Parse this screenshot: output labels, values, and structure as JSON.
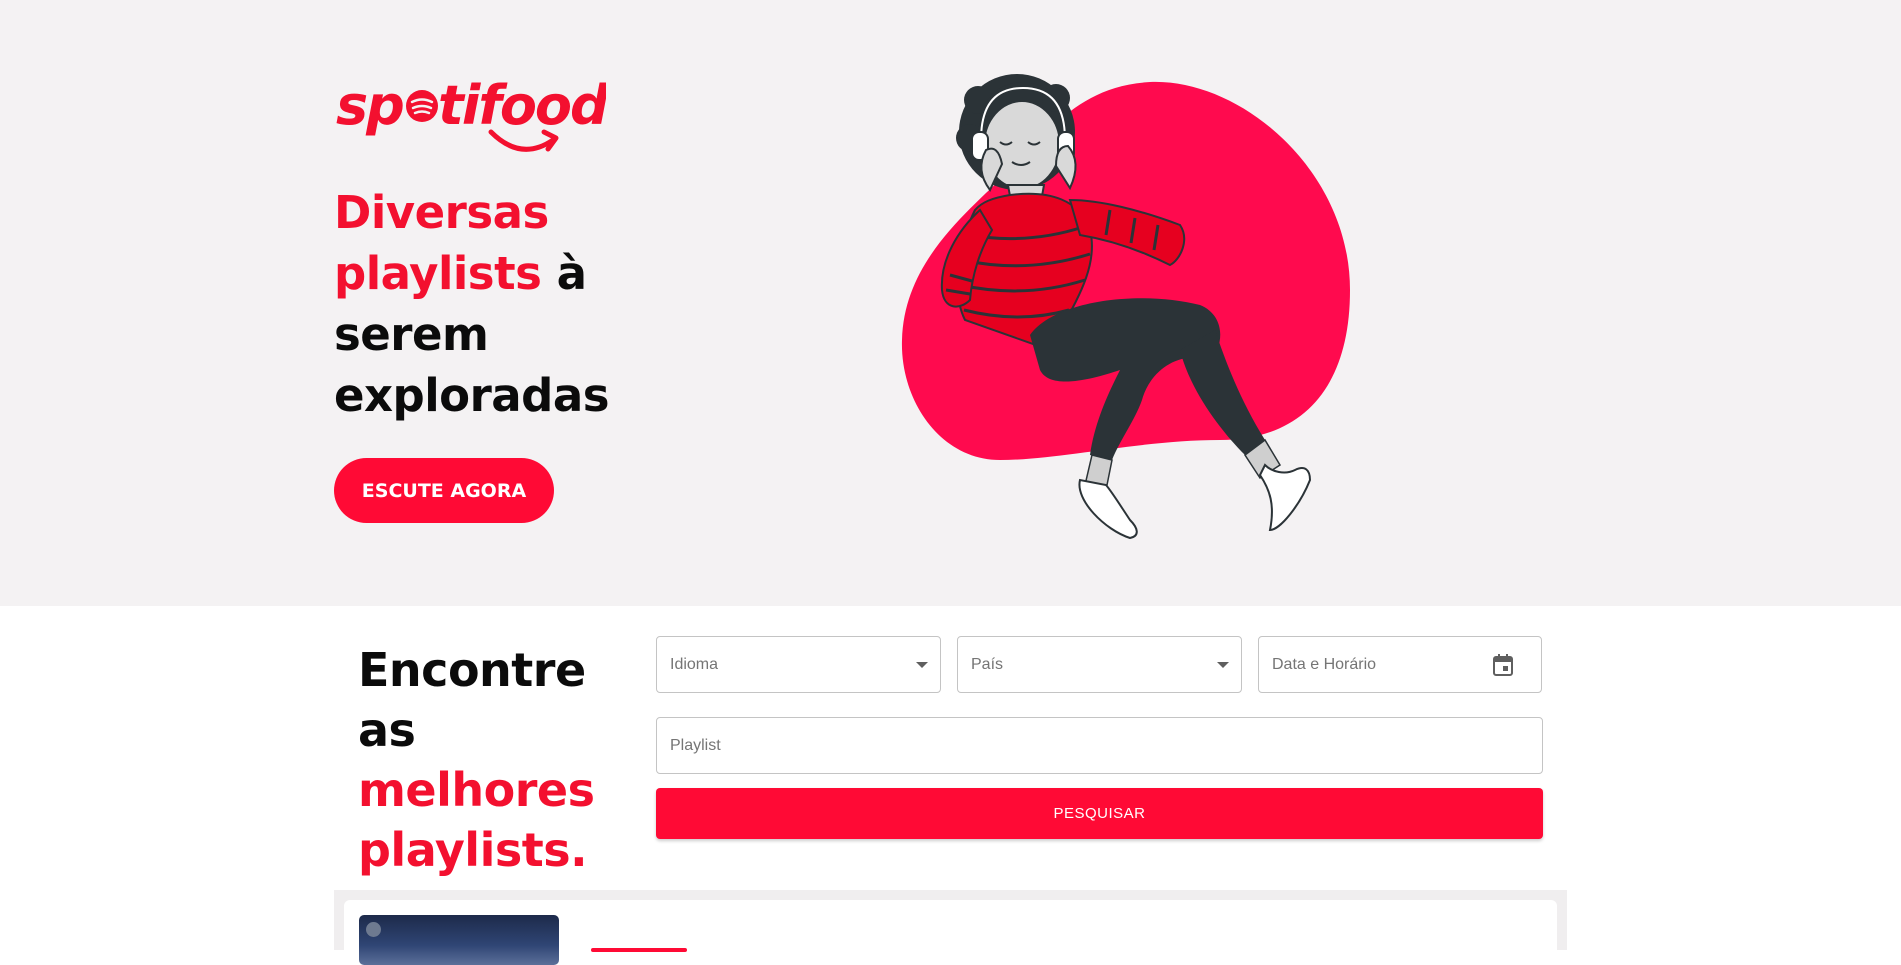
{
  "brand": {
    "name": "spotifood",
    "color": "#f3102f"
  },
  "hero": {
    "headline_red": "Diversas playlists",
    "headline_black_1": "à",
    "headline_black_2": "serem exploradas",
    "cta_label": "ESCUTE AGORA",
    "illustration": "woman-listening-headphones-illustration"
  },
  "search": {
    "heading_black": "Encontre as",
    "heading_red": "melhores playlists.",
    "idioma_placeholder": "Idioma",
    "pais_placeholder": "País",
    "datetime_placeholder": "Data e Horário",
    "playlist_placeholder": "Playlist",
    "submit_label": "PESQUISAR",
    "calendar_icon": "calendar-icon",
    "dropdown_icon": "arrow-drop-down-icon"
  },
  "colors": {
    "accent": "#ff0a35",
    "hero_bg": "#f4f2f3",
    "text": "#0b0b0b"
  }
}
